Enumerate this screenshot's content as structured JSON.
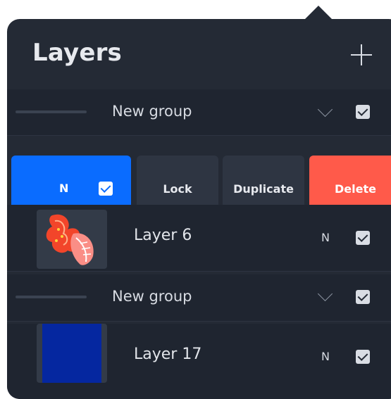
{
  "panel": {
    "title": "Layers",
    "add_icon": "plus-icon"
  },
  "groups": [
    {
      "label": "New group",
      "expanded_icon": "chevron-down-icon",
      "visible": true
    },
    {
      "label": "New group",
      "expanded_icon": "chevron-down-icon",
      "visible": true
    }
  ],
  "selected_layer": {
    "blend_mode": "N",
    "visible": true
  },
  "swipe_actions": {
    "lock": "Lock",
    "duplicate": "Duplicate",
    "delete": "Delete"
  },
  "layers": [
    {
      "name": "Layer 6",
      "blend_mode": "N",
      "visible": true,
      "thumbnail": "flower-artwork"
    },
    {
      "name": "Layer 17",
      "blend_mode": "N",
      "visible": true,
      "thumbnail": "solid-blue-fill"
    }
  ],
  "colors": {
    "panel_bg": "#242a35",
    "row_bg": "#1f2530",
    "selected_blue": "#0a6cff",
    "delete_red": "#ff5a4a",
    "action_gray": "#2e3542",
    "layer17_fill": "#0527a0"
  }
}
